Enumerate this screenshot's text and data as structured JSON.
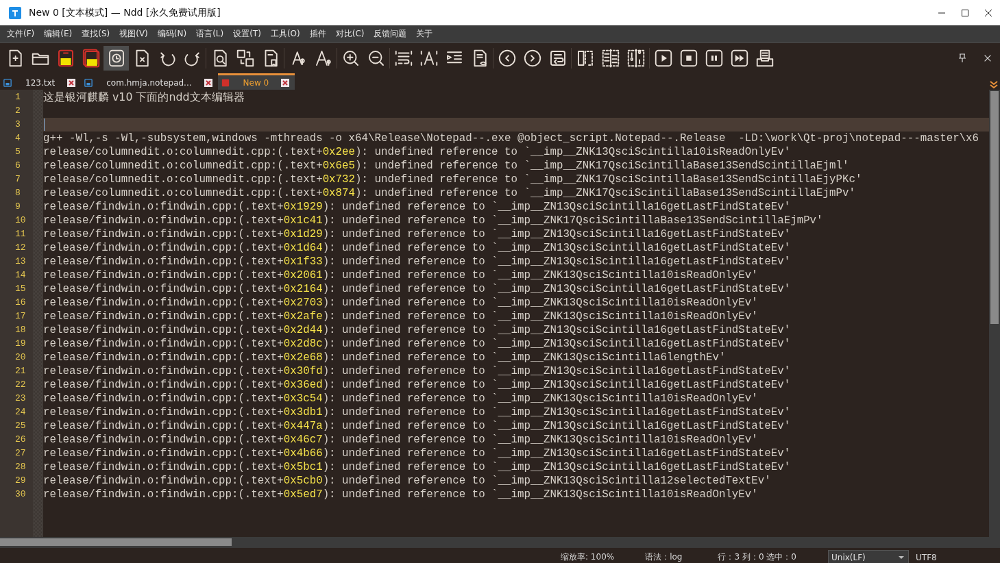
{
  "window": {
    "title": "New 0 [文本模式] — Ndd [永久免费试用版]"
  },
  "menu": [
    "文件(F)",
    "编辑(E)",
    "查找(S)",
    "视图(V)",
    "编码(N)",
    "语言(L)",
    "设置(T)",
    "工具(O)",
    "插件",
    "对比(C)",
    "反馈问题",
    "关于"
  ],
  "tabs": [
    {
      "label": "123.txt",
      "selected": false,
      "modified": false
    },
    {
      "label": "com.hmja.notepad...",
      "selected": false,
      "modified": false
    },
    {
      "label": "New 0",
      "selected": true,
      "modified": true
    }
  ],
  "editor": {
    "lines": [
      {
        "number": "1",
        "current": false,
        "parts": [
          {
            "kind": "plain",
            "text": "这是银河麒麟 v10 下面的ndd文本编辑器"
          }
        ]
      },
      {
        "number": "2",
        "current": false
      },
      {
        "number": "3",
        "current": true
      },
      {
        "number": "4",
        "current": false,
        "parts": [
          {
            "kind": "plain",
            "text": "g++ -Wl,-s -Wl,-subsystem,windows -mthreads -o x64\\Release\\Notepad--.exe @object_script.Notepad--.Release  -LD:\\work\\Qt-proj\\notepad---master\\x6"
          }
        ]
      },
      {
        "number": "5",
        "current": false,
        "parts": [
          {
            "kind": "plain",
            "text": "release/columnedit.o:columnedit.cpp:(.text+"
          },
          {
            "kind": "number",
            "text": "0x2ee"
          },
          {
            "kind": "plain",
            "text": "): undefined reference to `__imp__ZNK13QsciScintilla10isReadOnlyEv'"
          }
        ]
      },
      {
        "number": "6",
        "current": false,
        "parts": [
          {
            "kind": "plain",
            "text": "release/columnedit.o:columnedit.cpp:(.text+"
          },
          {
            "kind": "number",
            "text": "0x6e5"
          },
          {
            "kind": "plain",
            "text": "): undefined reference to `__imp__ZNK17QsciScintillaBase13SendScintillaEjml'"
          }
        ]
      },
      {
        "number": "7",
        "current": false,
        "parts": [
          {
            "kind": "plain",
            "text": "release/columnedit.o:columnedit.cpp:(.text+"
          },
          {
            "kind": "number",
            "text": "0x732"
          },
          {
            "kind": "plain",
            "text": "): undefined reference to `__imp__ZNK17QsciScintillaBase13SendScintillaEjyPKc'"
          }
        ]
      },
      {
        "number": "8",
        "current": false,
        "parts": [
          {
            "kind": "plain",
            "text": "release/columnedit.o:columnedit.cpp:(.text+"
          },
          {
            "kind": "number",
            "text": "0x874"
          },
          {
            "kind": "plain",
            "text": "): undefined reference to `__imp__ZNK17QsciScintillaBase13SendScintillaEjmPv'"
          }
        ]
      },
      {
        "number": "9",
        "current": false,
        "parts": [
          {
            "kind": "plain",
            "text": "release/findwin.o:findwin.cpp:(.text+"
          },
          {
            "kind": "number",
            "text": "0x1929"
          },
          {
            "kind": "plain",
            "text": "): undefined reference to `__imp__ZN13QsciScintilla16getLastFindStateEv'"
          }
        ]
      },
      {
        "number": "10",
        "current": false,
        "parts": [
          {
            "kind": "plain",
            "text": "release/findwin.o:findwin.cpp:(.text+"
          },
          {
            "kind": "number",
            "text": "0x1c41"
          },
          {
            "kind": "plain",
            "text": "): undefined reference to `__imp__ZNK17QsciScintillaBase13SendScintillaEjmPv'"
          }
        ]
      },
      {
        "number": "11",
        "current": false,
        "parts": [
          {
            "kind": "plain",
            "text": "release/findwin.o:findwin.cpp:(.text+"
          },
          {
            "kind": "number",
            "text": "0x1d29"
          },
          {
            "kind": "plain",
            "text": "): undefined reference to `__imp__ZN13QsciScintilla16getLastFindStateEv'"
          }
        ]
      },
      {
        "number": "12",
        "current": false,
        "parts": [
          {
            "kind": "plain",
            "text": "release/findwin.o:findwin.cpp:(.text+"
          },
          {
            "kind": "number",
            "text": "0x1d64"
          },
          {
            "kind": "plain",
            "text": "): undefined reference to `__imp__ZN13QsciScintilla16getLastFindStateEv'"
          }
        ]
      },
      {
        "number": "13",
        "current": false,
        "parts": [
          {
            "kind": "plain",
            "text": "release/findwin.o:findwin.cpp:(.text+"
          },
          {
            "kind": "number",
            "text": "0x1f33"
          },
          {
            "kind": "plain",
            "text": "): undefined reference to `__imp__ZN13QsciScintilla16getLastFindStateEv'"
          }
        ]
      },
      {
        "number": "14",
        "current": false,
        "parts": [
          {
            "kind": "plain",
            "text": "release/findwin.o:findwin.cpp:(.text+"
          },
          {
            "kind": "number",
            "text": "0x2061"
          },
          {
            "kind": "plain",
            "text": "): undefined reference to `__imp__ZNK13QsciScintilla10isReadOnlyEv'"
          }
        ]
      },
      {
        "number": "15",
        "current": false,
        "parts": [
          {
            "kind": "plain",
            "text": "release/findwin.o:findwin.cpp:(.text+"
          },
          {
            "kind": "number",
            "text": "0x2164"
          },
          {
            "kind": "plain",
            "text": "): undefined reference to `__imp__ZN13QsciScintilla16getLastFindStateEv'"
          }
        ]
      },
      {
        "number": "16",
        "current": false,
        "parts": [
          {
            "kind": "plain",
            "text": "release/findwin.o:findwin.cpp:(.text+"
          },
          {
            "kind": "number",
            "text": "0x2703"
          },
          {
            "kind": "plain",
            "text": "): undefined reference to `__imp__ZNK13QsciScintilla10isReadOnlyEv'"
          }
        ]
      },
      {
        "number": "17",
        "current": false,
        "parts": [
          {
            "kind": "plain",
            "text": "release/findwin.o:findwin.cpp:(.text+"
          },
          {
            "kind": "number",
            "text": "0x2afe"
          },
          {
            "kind": "plain",
            "text": "): undefined reference to `__imp__ZNK13QsciScintilla10isReadOnlyEv'"
          }
        ]
      },
      {
        "number": "18",
        "current": false,
        "parts": [
          {
            "kind": "plain",
            "text": "release/findwin.o:findwin.cpp:(.text+"
          },
          {
            "kind": "number",
            "text": "0x2d44"
          },
          {
            "kind": "plain",
            "text": "): undefined reference to `__imp__ZN13QsciScintilla16getLastFindStateEv'"
          }
        ]
      },
      {
        "number": "19",
        "current": false,
        "parts": [
          {
            "kind": "plain",
            "text": "release/findwin.o:findwin.cpp:(.text+"
          },
          {
            "kind": "number",
            "text": "0x2d8c"
          },
          {
            "kind": "plain",
            "text": "): undefined reference to `__imp__ZN13QsciScintilla16getLastFindStateEv'"
          }
        ]
      },
      {
        "number": "20",
        "current": false,
        "parts": [
          {
            "kind": "plain",
            "text": "release/findwin.o:findwin.cpp:(.text+"
          },
          {
            "kind": "number",
            "text": "0x2e68"
          },
          {
            "kind": "plain",
            "text": "): undefined reference to `__imp__ZNK13QsciScintilla6lengthEv'"
          }
        ]
      },
      {
        "number": "21",
        "current": false,
        "parts": [
          {
            "kind": "plain",
            "text": "release/findwin.o:findwin.cpp:(.text+"
          },
          {
            "kind": "number",
            "text": "0x30fd"
          },
          {
            "kind": "plain",
            "text": "): undefined reference to `__imp__ZN13QsciScintilla16getLastFindStateEv'"
          }
        ]
      },
      {
        "number": "22",
        "current": false,
        "parts": [
          {
            "kind": "plain",
            "text": "release/findwin.o:findwin.cpp:(.text+"
          },
          {
            "kind": "number",
            "text": "0x36ed"
          },
          {
            "kind": "plain",
            "text": "): undefined reference to `__imp__ZN13QsciScintilla16getLastFindStateEv'"
          }
        ]
      },
      {
        "number": "23",
        "current": false,
        "parts": [
          {
            "kind": "plain",
            "text": "release/findwin.o:findwin.cpp:(.text+"
          },
          {
            "kind": "number",
            "text": "0x3c54"
          },
          {
            "kind": "plain",
            "text": "): undefined reference to `__imp__ZNK13QsciScintilla10isReadOnlyEv'"
          }
        ]
      },
      {
        "number": "24",
        "current": false,
        "parts": [
          {
            "kind": "plain",
            "text": "release/findwin.o:findwin.cpp:(.text+"
          },
          {
            "kind": "number",
            "text": "0x3db1"
          },
          {
            "kind": "plain",
            "text": "): undefined reference to `__imp__ZN13QsciScintilla16getLastFindStateEv'"
          }
        ]
      },
      {
        "number": "25",
        "current": false,
        "parts": [
          {
            "kind": "plain",
            "text": "release/findwin.o:findwin.cpp:(.text+"
          },
          {
            "kind": "number",
            "text": "0x447a"
          },
          {
            "kind": "plain",
            "text": "): undefined reference to `__imp__ZN13QsciScintilla16getLastFindStateEv'"
          }
        ]
      },
      {
        "number": "26",
        "current": false,
        "parts": [
          {
            "kind": "plain",
            "text": "release/findwin.o:findwin.cpp:(.text+"
          },
          {
            "kind": "number",
            "text": "0x46c7"
          },
          {
            "kind": "plain",
            "text": "): undefined reference to `__imp__ZNK13QsciScintilla10isReadOnlyEv'"
          }
        ]
      },
      {
        "number": "27",
        "current": false,
        "parts": [
          {
            "kind": "plain",
            "text": "release/findwin.o:findwin.cpp:(.text+"
          },
          {
            "kind": "number",
            "text": "0x4b66"
          },
          {
            "kind": "plain",
            "text": "): undefined reference to `__imp__ZN13QsciScintilla16getLastFindStateEv'"
          }
        ]
      },
      {
        "number": "28",
        "current": false,
        "parts": [
          {
            "kind": "plain",
            "text": "release/findwin.o:findwin.cpp:(.text+"
          },
          {
            "kind": "number",
            "text": "0x5bc1"
          },
          {
            "kind": "plain",
            "text": "): undefined reference to `__imp__ZN13QsciScintilla16getLastFindStateEv'"
          }
        ]
      },
      {
        "number": "29",
        "current": false,
        "parts": [
          {
            "kind": "plain",
            "text": "release/findwin.o:findwin.cpp:(.text+"
          },
          {
            "kind": "number",
            "text": "0x5cb0"
          },
          {
            "kind": "plain",
            "text": "): undefined reference to `__imp__ZNK13QsciScintilla12selectedTextEv'"
          }
        ]
      },
      {
        "number": "30",
        "current": false,
        "parts": [
          {
            "kind": "plain",
            "text": "release/findwin.o:findwin.cpp:(.text+"
          },
          {
            "kind": "number",
            "text": "0x5ed7"
          },
          {
            "kind": "plain",
            "text": "): undefined reference to `__imp__ZNK13QsciScintilla10isReadOnlyEv'"
          }
        ]
      }
    ]
  },
  "status_bar": {
    "zoom": "缩放率: 100%",
    "syntax": "语法：log",
    "position": "行：3 列：0 选中：0",
    "line_ending": "Unix(LF)",
    "encoding": "UTF8"
  }
}
